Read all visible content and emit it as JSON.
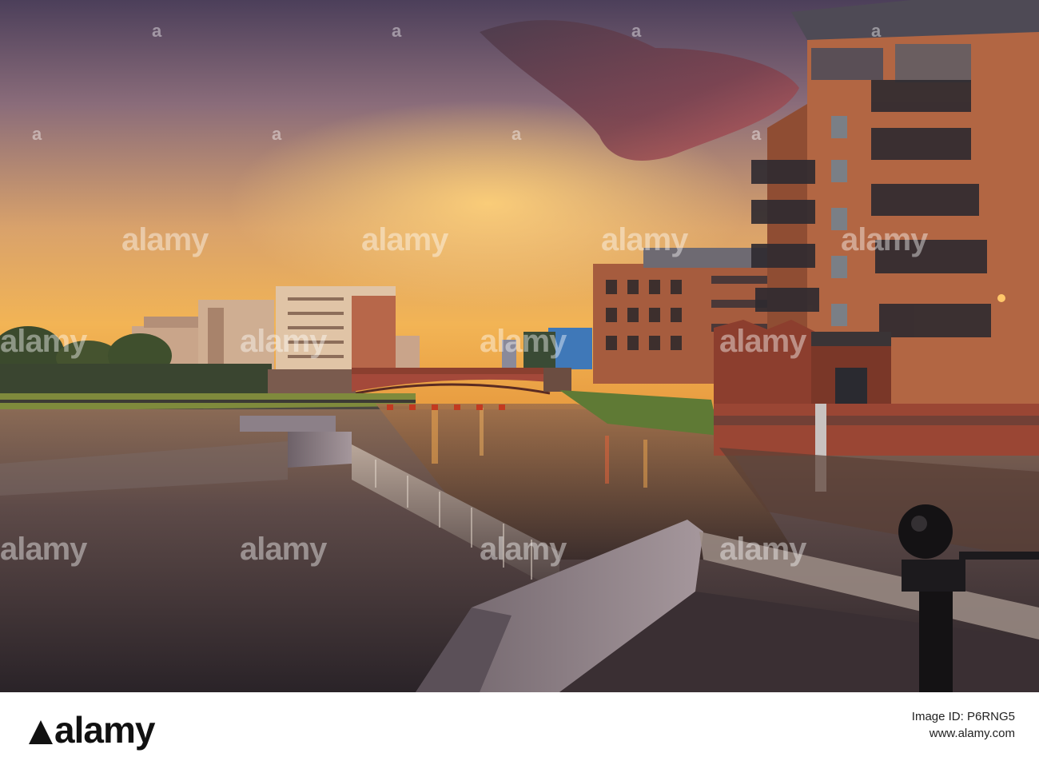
{
  "watermark": {
    "text": "alamy",
    "corner_mark": "a"
  },
  "footer": {
    "logo": "alamy",
    "image_id_label": "Image ID: P6RNG5",
    "site": "www.alamy.com"
  },
  "colors": {
    "sky_top": "#5a4a63",
    "sky_mid": "#c79a72",
    "sunset_glow": "#f0b25a",
    "brick": "#a4583a",
    "water": "#3c3037",
    "footer_bg": "#ffffff"
  }
}
